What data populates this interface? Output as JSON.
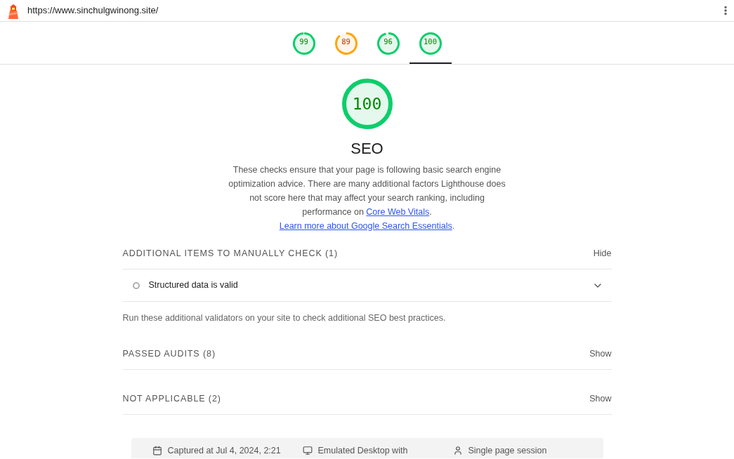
{
  "browser_bar": {
    "url": "https://www.sinchulgwinong.site/"
  },
  "score_tabs": [
    {
      "score": "99",
      "level": 0.99,
      "kind": "pass",
      "selected": false
    },
    {
      "score": "89",
      "level": 0.89,
      "kind": "average",
      "selected": false
    },
    {
      "score": "96",
      "level": 0.96,
      "kind": "pass",
      "selected": false
    },
    {
      "score": "100",
      "level": 1,
      "kind": "pass",
      "selected": true
    }
  ],
  "category": {
    "score": "100",
    "level": 1,
    "kind": "pass",
    "title": "SEO",
    "description": [
      {
        "kind": "text",
        "text": "These checks ensure that your page is following basic search engine optimization advice. There are many additional factors Lighthouse does not score here that may affect your search ranking, including performance on "
      },
      {
        "kind": "link",
        "text": "Core Web Vitals"
      },
      {
        "kind": "text",
        "text": ". "
      },
      {
        "kind": "link",
        "text": "Learn more about Google Search Essentials"
      },
      {
        "kind": "text",
        "text": "."
      }
    ]
  },
  "groups": [
    {
      "title": "ADDITIONAL ITEMS TO MANUALLY CHECK (1)",
      "toggle": "Hide",
      "audits": [
        {
          "title": "Structured data is valid",
          "expanded": false
        }
      ],
      "note": "Run these additional validators on your site to check additional SEO best practices."
    },
    {
      "title": "PASSED AUDITS (8)",
      "toggle": "Show"
    },
    {
      "title": "NOT APPLICABLE (2)",
      "toggle": "Show"
    }
  ],
  "footer": {
    "items": [
      {
        "kind": "calendar",
        "text": "Captured at Jul 4, 2024, 2:21"
      },
      {
        "kind": "monitor",
        "text": "Emulated Desktop with"
      },
      {
        "kind": "person",
        "text": "Single page session"
      }
    ]
  }
}
